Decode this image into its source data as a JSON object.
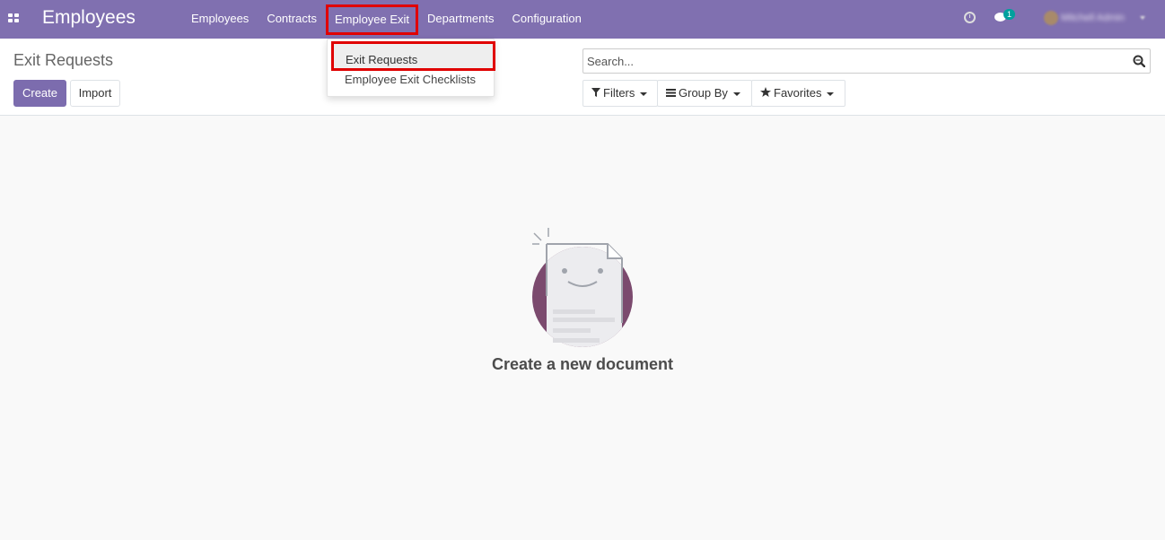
{
  "navbar": {
    "app_title": "Employees",
    "menu": [
      {
        "label": "Employees"
      },
      {
        "label": "Contracts"
      },
      {
        "label": "Employee Exit"
      },
      {
        "label": "Departments"
      },
      {
        "label": "Configuration"
      }
    ],
    "chat_badge": "1",
    "user_name": "Mitchell Admin",
    "accent_color": "#8070b0"
  },
  "dropdown": {
    "items": [
      {
        "label": "Exit Requests"
      },
      {
        "label": "Employee Exit Checklists"
      }
    ],
    "highlight_color": "#e00000"
  },
  "control_panel": {
    "breadcrumb": "Exit Requests",
    "create_label": "Create",
    "import_label": "Import",
    "search_placeholder": "Search...",
    "filters_label": "Filters",
    "group_by_label": "Group By",
    "favorites_label": "Favorites"
  },
  "empty_state": {
    "title": "Create a new document"
  }
}
